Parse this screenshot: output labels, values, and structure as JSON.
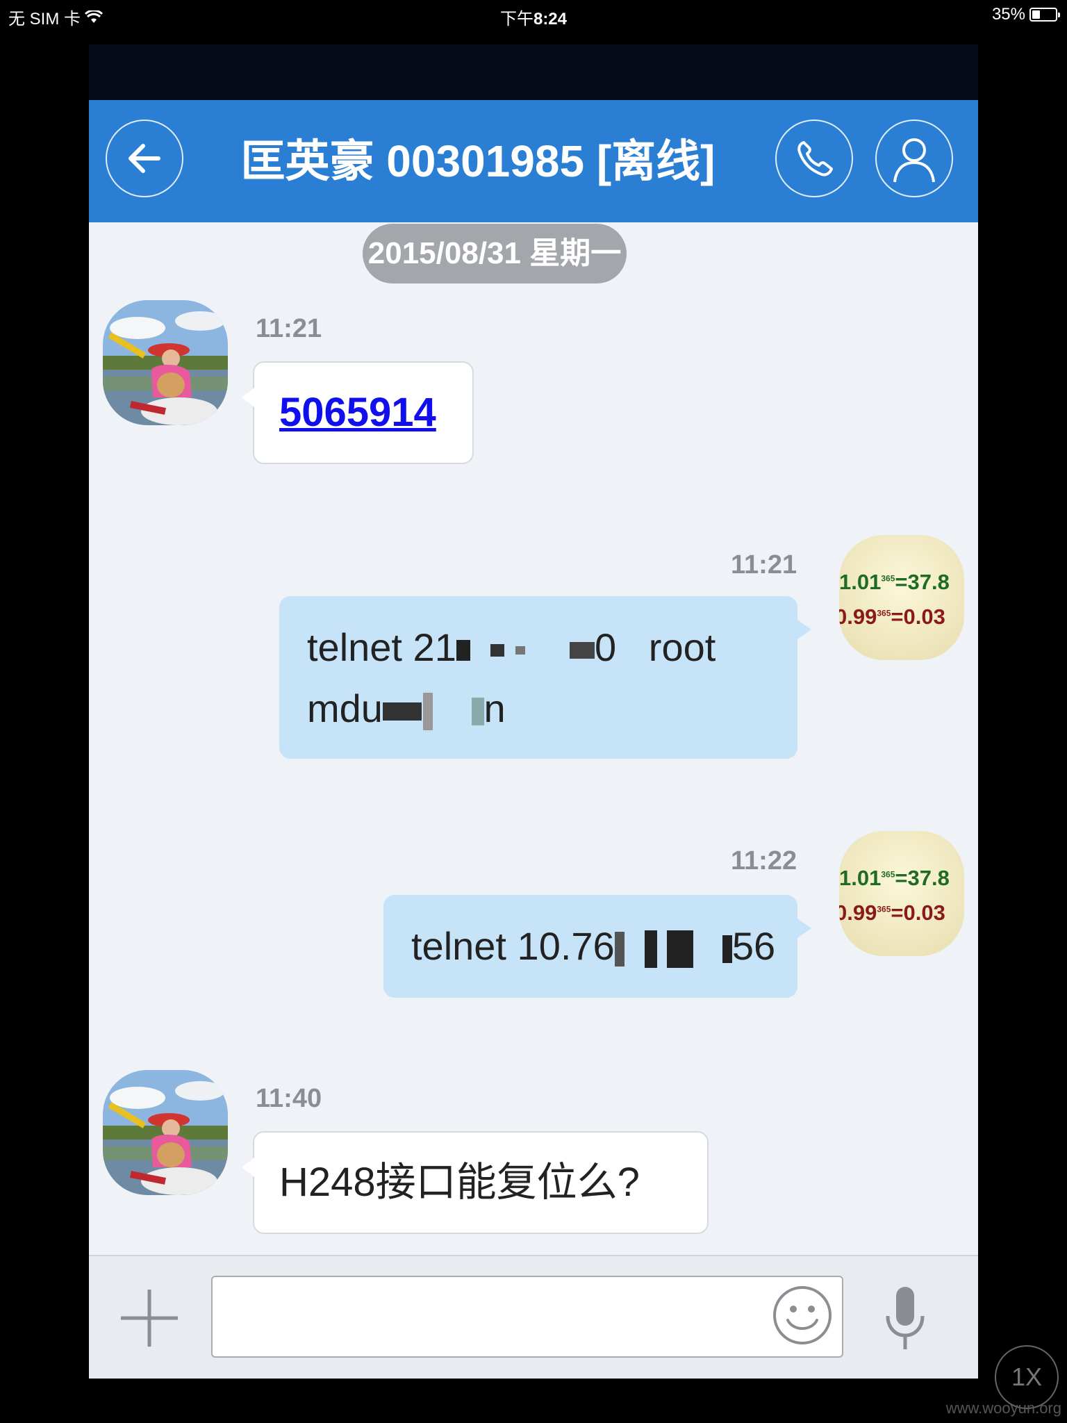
{
  "status_bar": {
    "carrier": "无 SIM 卡",
    "time_prefix": "下午",
    "time": "8:24",
    "battery_percent_label": "35%",
    "battery_level": 0.35
  },
  "header": {
    "title": "匡英豪 00301985 [离线]",
    "back_icon": "arrow-left-icon",
    "call_icon": "phone-icon",
    "profile_icon": "person-icon"
  },
  "date_divider": "2015/08/31 星期一",
  "messages": [
    {
      "direction": "incoming",
      "time": "11:21",
      "text": "5065914",
      "is_link": true
    },
    {
      "direction": "outgoing",
      "time": "11:21",
      "text_line1_a": "telnet 21",
      "text_line1_b": "0   root",
      "text_line2_a": "mdu",
      "text_line2_b": "n",
      "redacted": true
    },
    {
      "direction": "outgoing",
      "time": "11:22",
      "text_a": "telnet 10.76",
      "text_b": "56",
      "redacted": true
    },
    {
      "direction": "incoming",
      "time": "11:40",
      "text": "H248接口能复位么?"
    }
  ],
  "my_avatar": {
    "line1_base": "1.01",
    "line1_exp": "365",
    "line1_result": "=37.8",
    "line2_base": "0.99",
    "line2_exp": "365",
    "line2_result": "=0.03"
  },
  "input": {
    "placeholder": "",
    "plus_icon": "plus-icon",
    "emoji_icon": "smiley-icon",
    "mic_icon": "microphone-icon"
  },
  "overlay": {
    "zoom": "1X",
    "watermark": "www.wooyun.org"
  },
  "colors": {
    "header": "#2a7fd4",
    "outgoing_bubble": "#c6e3f8",
    "incoming_bubble": "#ffffff",
    "chat_bg": "#eff3f8",
    "link": "#1010ee"
  }
}
